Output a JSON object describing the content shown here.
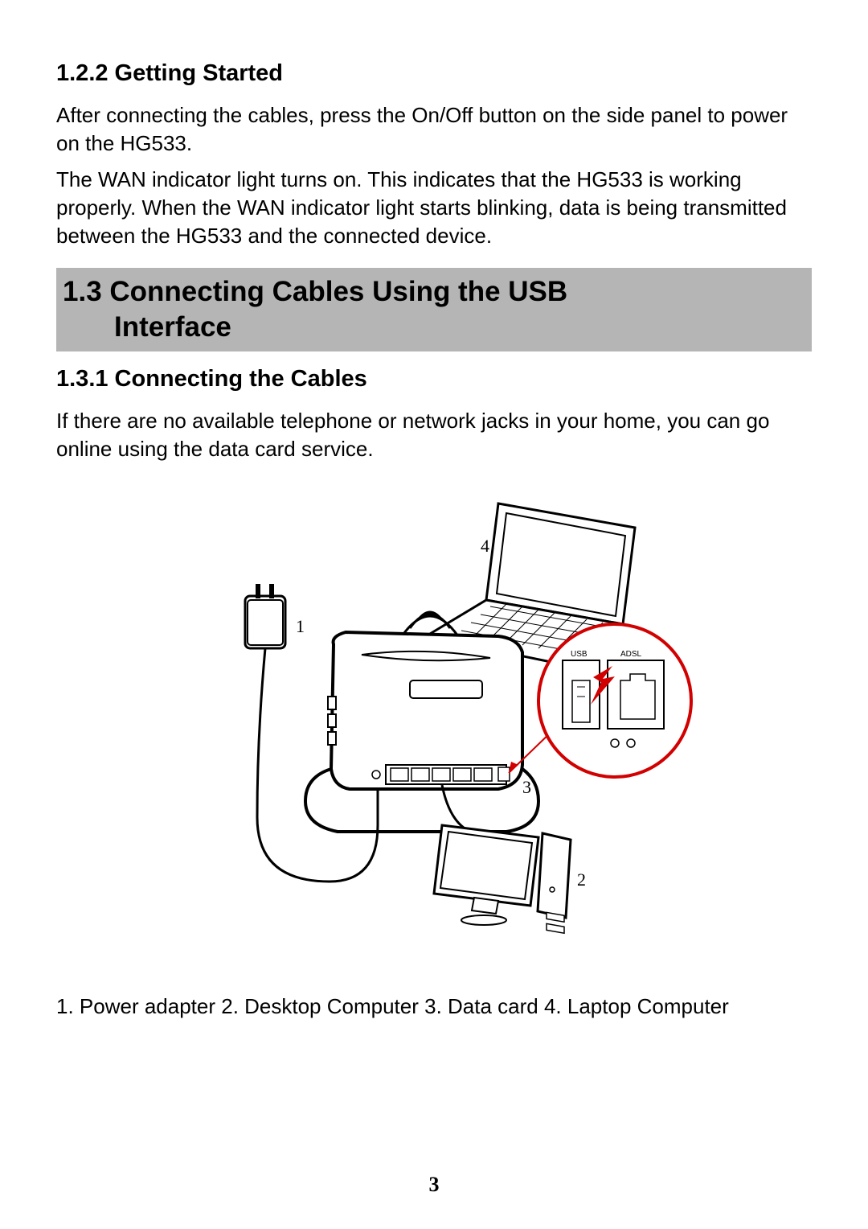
{
  "sec122": {
    "heading": "1.2.2 Getting Started",
    "p1": "After connecting the cables, press the On/Off button on the side panel to power on the HG533.",
    "p2": "The WAN indicator light turns on. This indicates that the HG533 is working properly. When the WAN indicator light starts blinking, data is being transmitted between the HG533 and the connected device."
  },
  "sec13": {
    "num": "1.3",
    "title_line1": "Connecting Cables Using the USB",
    "title_line2": "Interface"
  },
  "sec131": {
    "heading": "1.3.1 Connecting the Cables",
    "p1": "If there are no available telephone or network jacks in your home, you can go online using the data card service."
  },
  "figure": {
    "callouts": {
      "c1": "1",
      "c2": "2",
      "c3": "3",
      "c4": "4"
    },
    "port_labels": {
      "usb": "USB",
      "adsl": "ADSL"
    },
    "legend": "1. Power adapter 2.  Desktop Computer 3. Data card 4. Laptop Computer"
  },
  "page_number": "3"
}
